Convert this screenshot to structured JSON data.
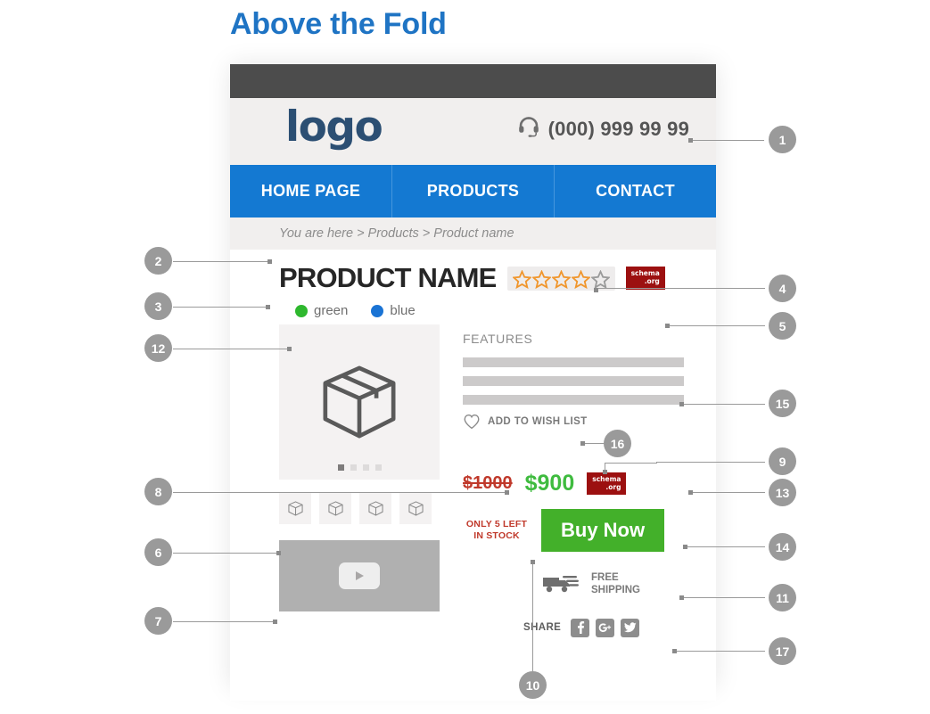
{
  "page": {
    "title": "Above the Fold",
    "title_color": "#1f74c4"
  },
  "mockup": {
    "header": {
      "logo": "logo",
      "phone": "(000) 999 99 99",
      "phone_icon": "headset-icon"
    },
    "nav": {
      "items": [
        {
          "label": "HOME PAGE"
        },
        {
          "label": "PRODUCTS"
        },
        {
          "label": "CONTACT"
        }
      ],
      "background": "#1479d2"
    },
    "breadcrumb": "You are here > Products > Product name",
    "product": {
      "name": "PRODUCT NAME",
      "rating": {
        "value": 4,
        "max": 5,
        "filled_color": "#f0962d",
        "empty_color": "#9a9a9a"
      },
      "schema_badge": {
        "line1": "schema",
        "line2": ".org",
        "color": "#9c1010"
      },
      "colors": [
        {
          "label": "green",
          "swatch": "#2eb82e"
        },
        {
          "label": "blue",
          "swatch": "#1a73d4"
        }
      ],
      "gallery": {
        "main_icon": "box-icon",
        "pagination": {
          "count": 4,
          "active_index": 0
        },
        "thumbnails": [
          "box-icon",
          "box-icon",
          "box-icon",
          "box-icon"
        ],
        "video_icon": "play-icon"
      },
      "features": {
        "title": "FEATURES",
        "lines": [
          "",
          "",
          ""
        ]
      },
      "wishlist": {
        "label": "ADD TO WISH LIST",
        "icon": "heart-icon"
      },
      "pricing": {
        "old_price": "$1000",
        "new_price": "$900",
        "old_color": "#c0392b",
        "new_color": "#3fbb3f",
        "schema_badge": {
          "line1": "schema",
          "line2": ".org",
          "color": "#9c1010"
        }
      },
      "stock_notice": {
        "line1": "ONLY 5 LEFT",
        "line2": "IN STOCK",
        "color": "#c0392b"
      },
      "buy_button": {
        "label": "Buy Now",
        "color": "#43b02a"
      },
      "shipping": {
        "line1": "FREE",
        "line2": "SHIPPING",
        "icon": "delivery-truck-icon"
      },
      "share": {
        "label": "SHARE",
        "networks": [
          {
            "name": "facebook-icon",
            "glyph": "f"
          },
          {
            "name": "google-plus-icon",
            "glyph": "g+"
          },
          {
            "name": "twitter-icon",
            "glyph": "t"
          }
        ]
      }
    }
  },
  "callouts": [
    {
      "number": "1"
    },
    {
      "number": "2"
    },
    {
      "number": "3"
    },
    {
      "number": "4"
    },
    {
      "number": "5"
    },
    {
      "number": "6"
    },
    {
      "number": "7"
    },
    {
      "number": "8"
    },
    {
      "number": "9"
    },
    {
      "number": "10"
    },
    {
      "number": "11"
    },
    {
      "number": "12"
    },
    {
      "number": "13"
    },
    {
      "number": "14"
    },
    {
      "number": "15"
    },
    {
      "number": "16"
    },
    {
      "number": "17"
    }
  ]
}
